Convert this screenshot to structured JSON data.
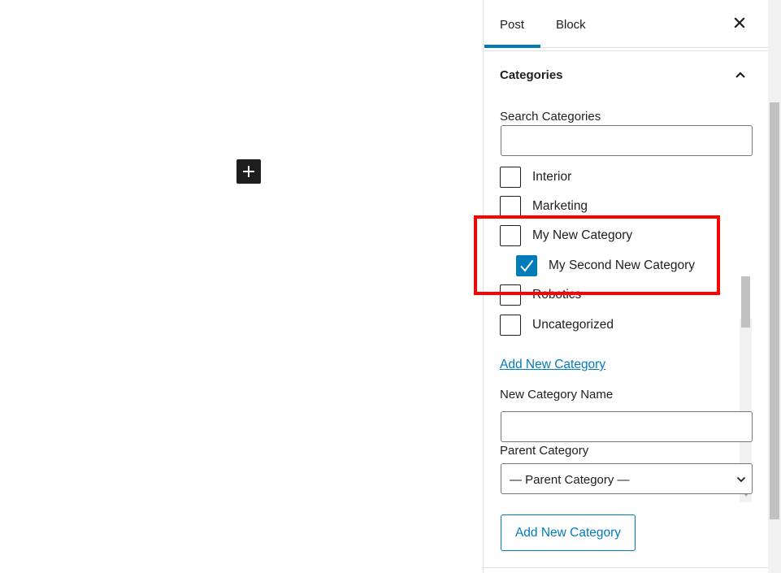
{
  "canvas": {
    "inserter_icon": "plus-icon"
  },
  "sidebar": {
    "tabs": [
      {
        "label": "Post",
        "active": true
      },
      {
        "label": "Block",
        "active": false
      }
    ],
    "close_icon": "close-icon",
    "accent_color": "#007cba"
  },
  "categories_panel": {
    "title": "Categories",
    "expanded": true,
    "search_label": "Search Categories",
    "search_value": "",
    "items": [
      {
        "label": "Interior",
        "checked": false,
        "level": 0
      },
      {
        "label": "Marketing",
        "checked": false,
        "level": 0
      },
      {
        "label": "My New Category",
        "checked": false,
        "level": 0
      },
      {
        "label": "My Second New Category",
        "checked": true,
        "level": 1
      },
      {
        "label": "Robotics",
        "checked": false,
        "level": 0
      },
      {
        "label": "Uncategorized",
        "checked": false,
        "level": 0
      }
    ],
    "add_new_link": "Add New Category",
    "new_name_label": "New Category Name",
    "new_name_value": "",
    "parent_label": "Parent Category",
    "parent_selected": "— Parent Category —",
    "add_button": "Add New Category"
  },
  "annotation": {
    "highlight_color": "#ff0000"
  }
}
